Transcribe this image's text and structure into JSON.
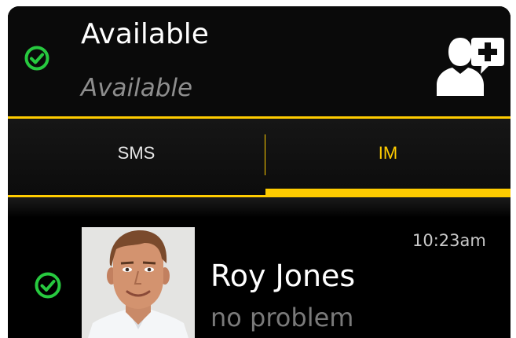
{
  "colors": {
    "accent": "#ffcc00",
    "status_green": "#27c93f",
    "background": "#000000",
    "muted_text": "#8e8e8e"
  },
  "header": {
    "status_title": "Available",
    "status_subtitle": "Available",
    "status_icon": "check-circle-icon",
    "add_contact_icon": "add-contact-icon"
  },
  "tabs": [
    {
      "label": "SMS",
      "active": false
    },
    {
      "label": "IM",
      "active": true
    }
  ],
  "conversations": [
    {
      "name": "Roy Jones",
      "last_message": "no problem",
      "time": "10:23am",
      "status_icon": "check-circle-icon",
      "avatar_icon": "contact-photo"
    }
  ]
}
